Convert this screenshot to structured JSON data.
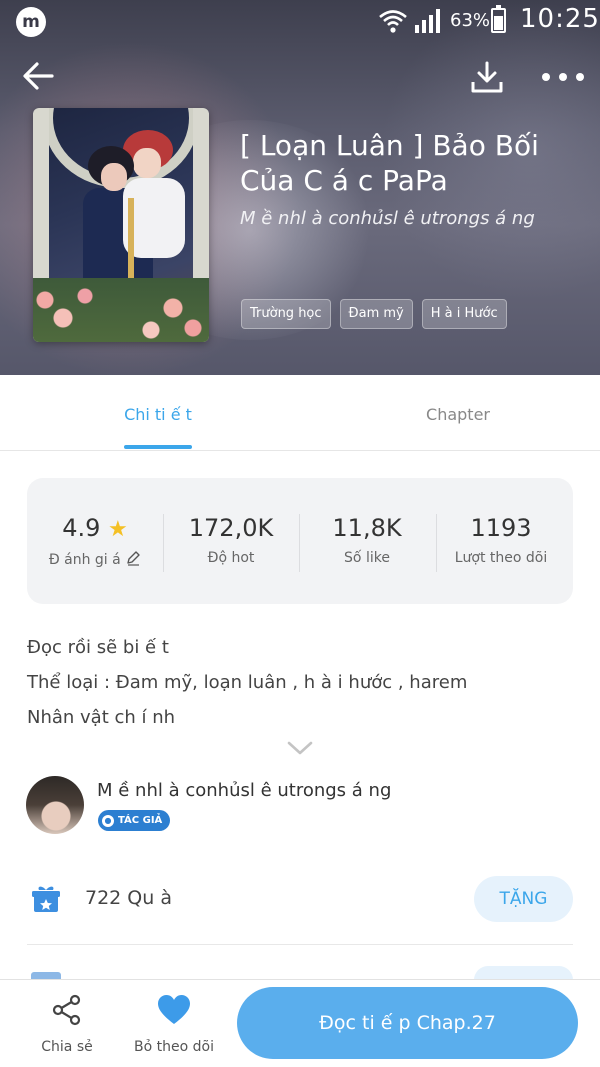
{
  "status_bar": {
    "app_icon_letter": "m",
    "battery_percent": "63%",
    "time": "10:25",
    "icons": [
      "wifi-icon",
      "signal-icon",
      "battery-icon"
    ]
  },
  "header": {
    "icons": [
      "back-arrow-icon",
      "download-icon",
      "more-icon"
    ],
    "title": "[ Loạn Luân ] Bảo Bối Của C á c PaPa",
    "author_line": "M ề nhl à conhủsl ê utrongs á ng",
    "tags": [
      "Trường học",
      "Đam mỹ",
      "H à i Hước"
    ]
  },
  "tabs": [
    {
      "label": "Chi ti ế t",
      "active": true
    },
    {
      "label": "Chapter",
      "active": false
    }
  ],
  "stats": {
    "rating": {
      "value": "4.9",
      "label": "Đ ánh gi á"
    },
    "hot": {
      "value": "172,0K",
      "label": "Độ hot"
    },
    "likes": {
      "value": "11,8K",
      "label": "Số like"
    },
    "follows": {
      "value": "1193",
      "label": "Lượt theo dõi"
    }
  },
  "description": {
    "lines": [
      "Đọc rồi sẽ bi ế t",
      "Thể loại : Đam mỹ,  loạn luân , h à i hước , harem",
      "Nhân vật ch  í nh"
    ]
  },
  "author": {
    "name": "M ề nhl à conhủsl ê utrongs á ng",
    "badge": "TÁC GIẢ"
  },
  "gifts": {
    "text": "722 Qu à",
    "button_label": "TẶNG"
  },
  "bottom_bar": {
    "share_label": "Chia sẻ",
    "unfollow_label": "Bỏ theo dõi",
    "read_button_label": "Đọc ti ế p Chap.27"
  },
  "colors": {
    "accent": "#3ba6ea",
    "primary_button": "#5aaeed",
    "heart": "#3d9be9",
    "star": "#f4c025",
    "badge": "#2c7fd1"
  }
}
